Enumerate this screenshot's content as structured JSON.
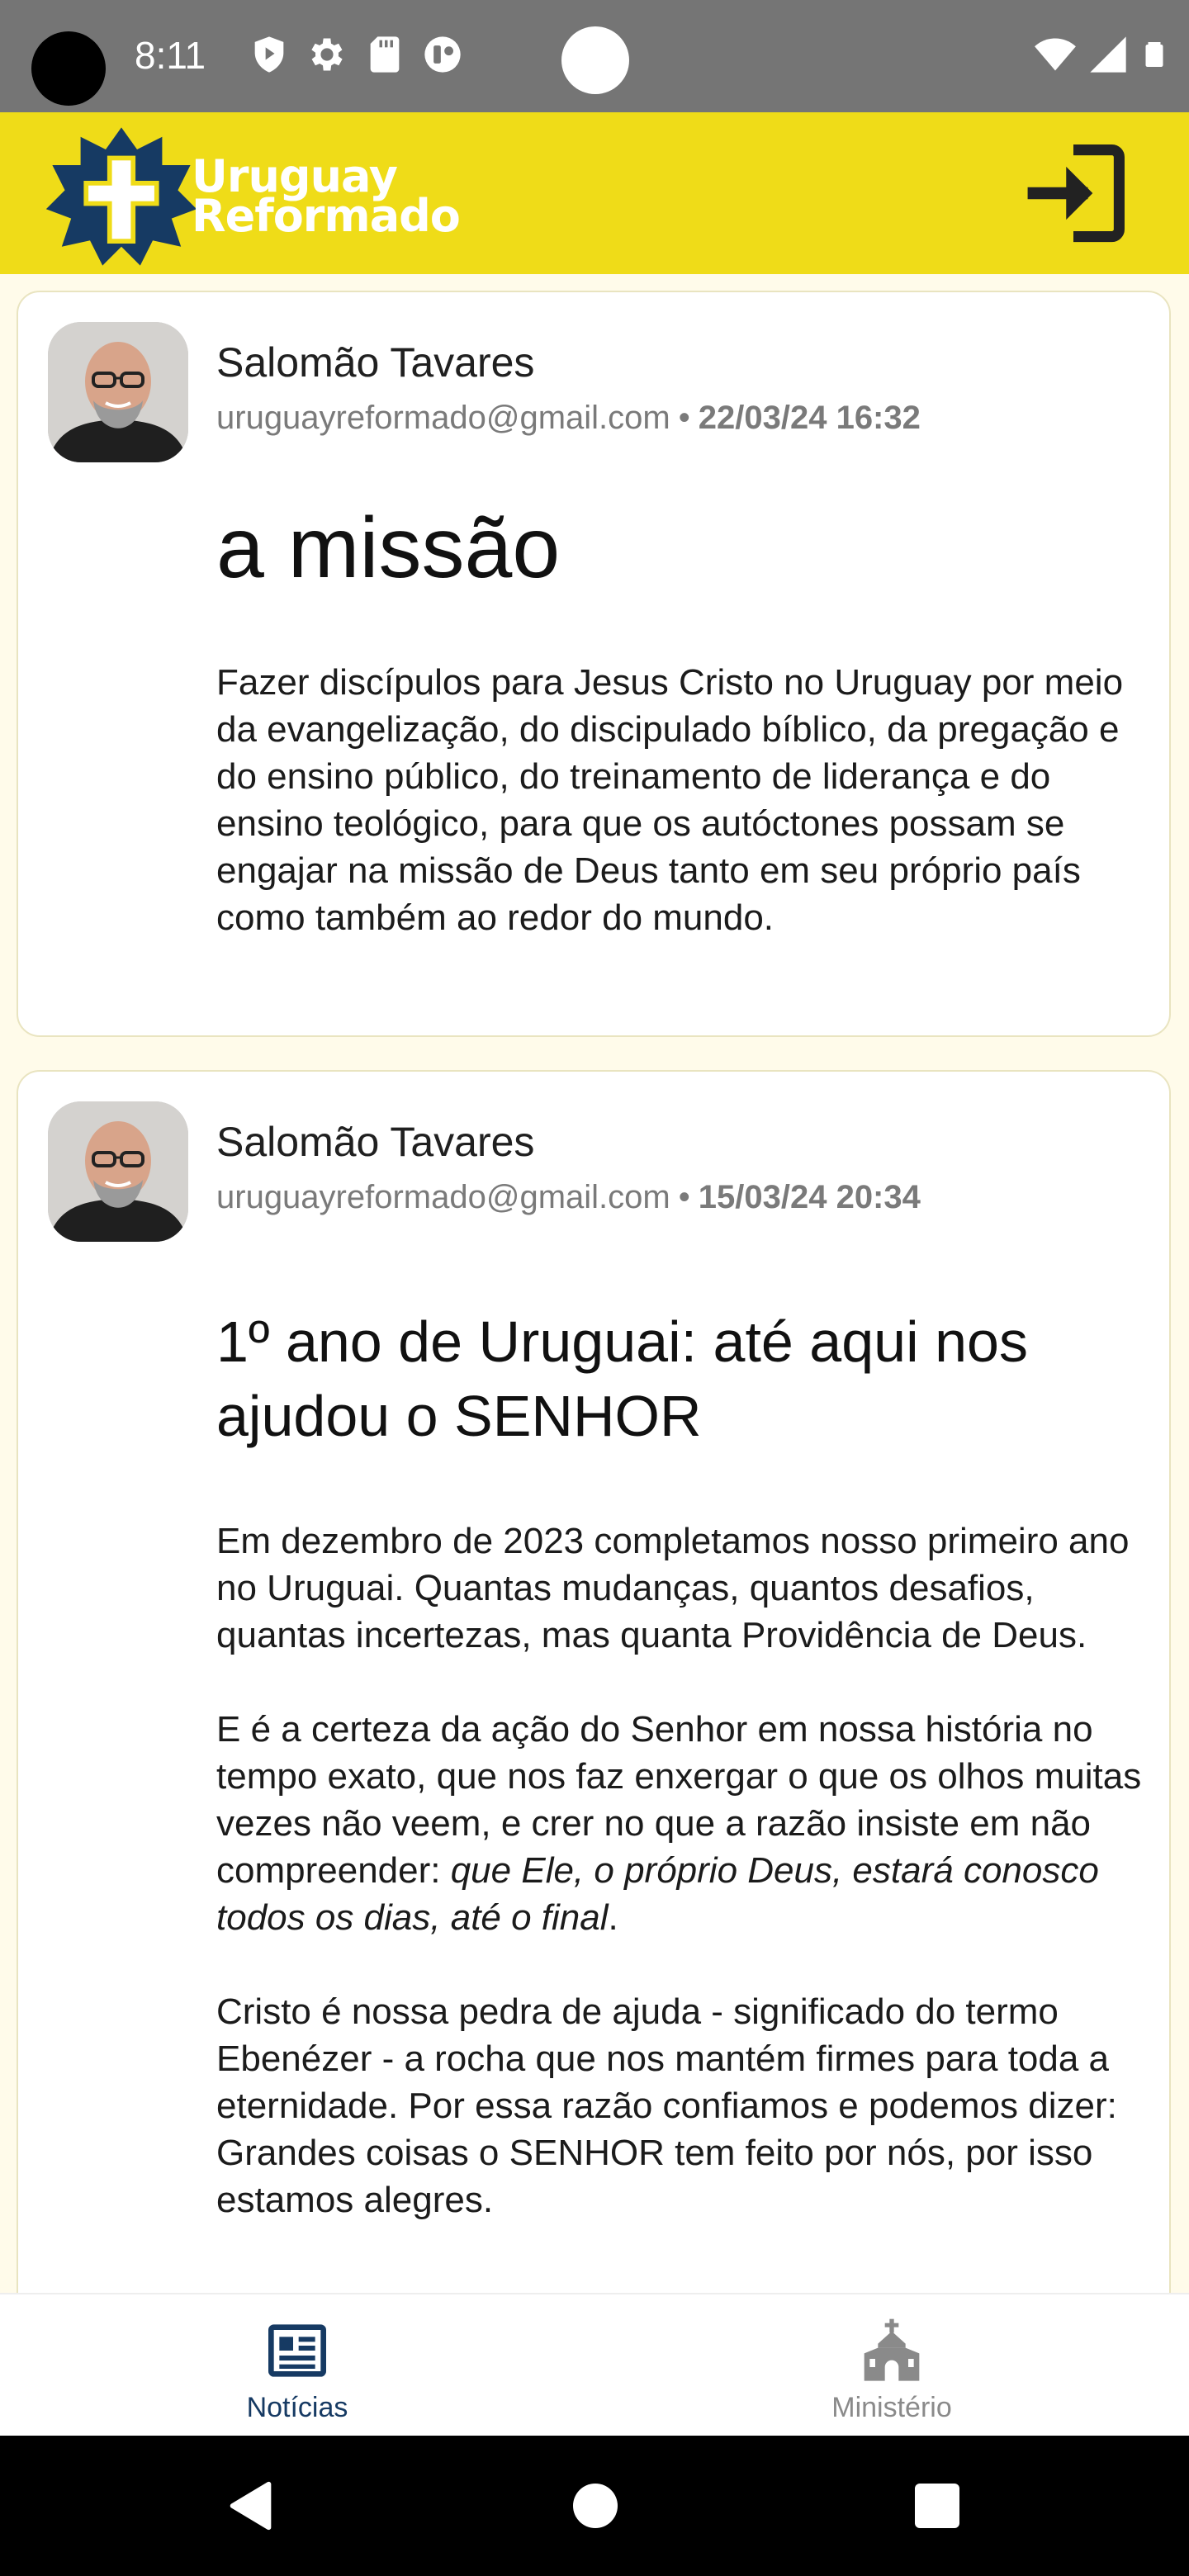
{
  "status_bar": {
    "time": "8:11",
    "left_icons": [
      "play-shield-icon",
      "gear-icon",
      "sd-card-icon",
      "vpn-key-icon"
    ],
    "right_icons": [
      "wifi-icon",
      "signal-icon",
      "battery-icon"
    ]
  },
  "app_bar": {
    "logo_line1": "Uruguay",
    "logo_line2": "Reformado",
    "login_icon": "login-icon",
    "background_color": "#efdc18"
  },
  "posts": [
    {
      "author": "Salomão Tavares",
      "email": "uruguayreformado@gmail.com",
      "separator": "•",
      "date": "22/03/24 16:32",
      "title": "a missão",
      "paragraphs": [
        "Fazer discípulos para Jesus Cristo no Uruguay por meio da evangelização, do discipulado bíblico, da pregação e do ensino público, do treinamento de liderança e do ensino teológico, para que os autóctones possam se engajar na missão de Deus tanto em seu próprio país como também ao redor do mundo."
      ]
    },
    {
      "author": "Salomão Tavares",
      "email": "uruguayreformado@gmail.com",
      "separator": "•",
      "date": "15/03/24 20:34",
      "title": "1º ano de Uruguai: até aqui nos ajudou o SENHOR",
      "paragraphs": [
        "Em dezembro de 2023 completamos nosso primeiro ano no Uruguai. Quantas mudanças, quantos desafios, quantas incertezas, mas quanta Providência de Deus.",
        "E é a certeza da ação do Senhor em nossa história no tempo exato, que nos faz enxergar o que os olhos muitas vezes não veem, e crer no que a razão insiste em não compreender: ",
        "que Ele, o próprio Deus, estará conosco todos os dias, até o final",
        ".",
        "Cristo é nossa pedra de ajuda - significado do termo Ebenézer - a rocha que nos mantém firmes para toda a eternidade. Por essa razão confiamos e podemos dizer: Grandes coisas o SENHOR tem feito por nós, por isso estamos alegres."
      ]
    }
  ],
  "bottom_nav": {
    "items": [
      {
        "label": "Notícias",
        "icon": "newspaper-icon",
        "active": true,
        "color": "#163a63"
      },
      {
        "label": "Ministério",
        "icon": "church-icon",
        "active": false,
        "color": "#8a8a8a"
      }
    ]
  },
  "system_nav": {
    "icons": [
      "back-icon",
      "home-icon",
      "recents-icon"
    ]
  }
}
